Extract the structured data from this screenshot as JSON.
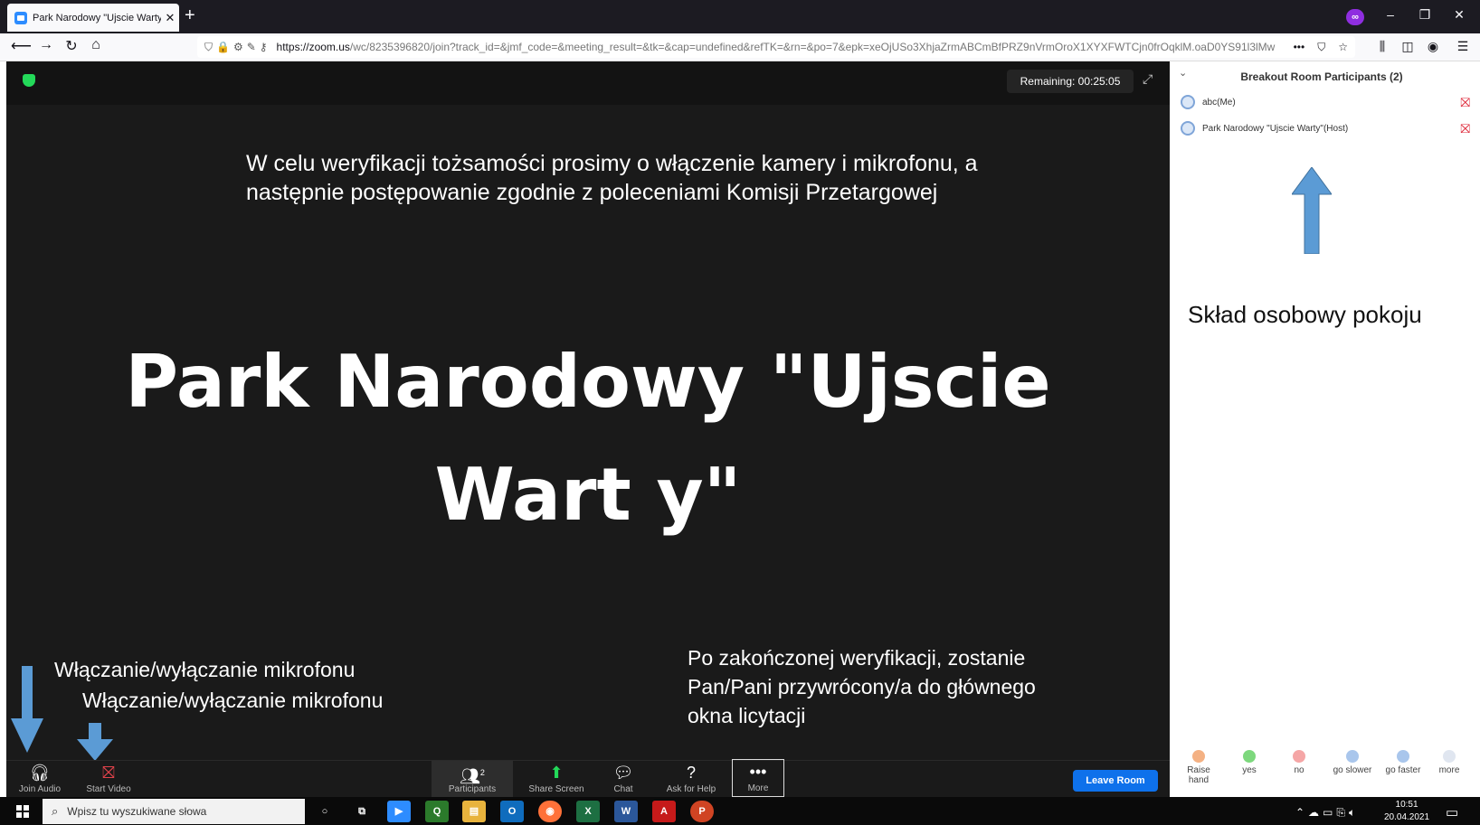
{
  "browser": {
    "tab_title": "Park Narodowy \"Ujscie Warty\"",
    "url_prefix": "https://zoom.us",
    "url_rest": "/wc/8235396820/join?track_id=&jmf_code=&meeting_result=&tk=&cap=undefined&refTK=&rn=&po=7&epk=xeOjUSo3XhjaZrmABCmBfPRZ9nVrmOroX1XYXFWTCjn0frOqklM.oaD0YS91l3lMw"
  },
  "meeting": {
    "remaining": "Remaining: 00:25:05",
    "note_top": "W celu weryfikacji tożsamości prosimy o włączenie kamery i mikrofonu, a następnie postępowanie zgodnie z poleceniami Komisji Przetargowej",
    "host_display_name": "Park Narodowy \"Ujscie Wart y\"",
    "note_bottom": "Po zakończonej weryfikacji, zostanie Pan/Pani przywrócony/a do głównego okna licytacji",
    "label_mic": "Włączanie/wyłączanie mikrofonu",
    "label_video": "Włączanie/wyłączanie mikrofonu"
  },
  "toolbar": {
    "join_audio": "Join Audio",
    "start_video": "Start Video",
    "participants": "Participants",
    "participants_count": "2",
    "share_screen": "Share Screen",
    "chat": "Chat",
    "ask_for_help": "Ask for Help",
    "more": "More",
    "leave_room": "Leave Room"
  },
  "panel": {
    "title": "Breakout Room Participants (2)",
    "participants": [
      {
        "name": "abc(Me)"
      },
      {
        "name": "Park Narodowy \"Ujscie Warty\"(Host)"
      }
    ],
    "label": "Skład osobowy pokoju",
    "reactions": [
      "Raise hand",
      "yes",
      "no",
      "go slower",
      "go faster",
      "more"
    ]
  },
  "taskbar": {
    "search_placeholder": "Wpisz tu wyszukiwane słowa",
    "time": "10:51",
    "date": "20.04.2021"
  },
  "colors": {
    "zoom_bg": "#1a1a1a",
    "accent_blue": "#0e71eb",
    "arrow_blue": "#5b9bd5"
  }
}
